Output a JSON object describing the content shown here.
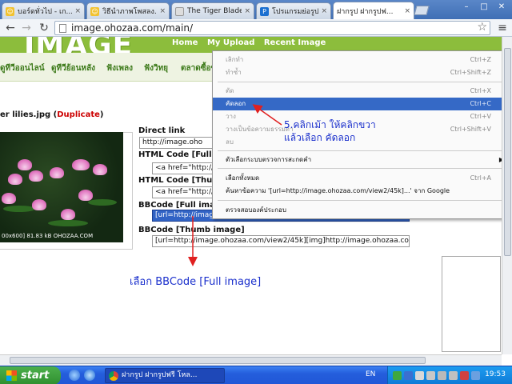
{
  "tabs": [
    {
      "title": "บอร์ดทั่วไป - เก...",
      "active": false
    },
    {
      "title": "วิธีนำภาพโพสลง...",
      "active": false
    },
    {
      "title": "The Tiger Blade",
      "active": false
    },
    {
      "title": "โปรแกรมย่อรูป",
      "active": false
    },
    {
      "title": "ฝากรูป ฝากรูปฟ...",
      "active": true
    }
  ],
  "toolbar": {
    "url": "image.ohozaa.com/main/",
    "back_icon": "back-arrow",
    "forward_icon": "forward-arrow",
    "reload_icon": "reload",
    "bookmark_icon": "star",
    "menu_icon": "wrench"
  },
  "site": {
    "logo": "IMAGE",
    "topnav": [
      "Home",
      "My Upload",
      "Recent Image"
    ],
    "catnav": [
      "ดูทีวีออนไลน์",
      "ดูทีวีย้อนหลัง",
      "ฟังเพลง",
      "ฟังวิทยุ",
      "ตลาดซื้อข"
    ],
    "file_title": "er lilies.jpg",
    "file_title_paren_open": " (",
    "file_dup": "Duplicate",
    "file_title_paren_close": ")",
    "photo_caption": "00x600] 81.83 kB OHOZAA.COM"
  },
  "codes": {
    "direct_link_label": "Direct link",
    "direct_link_value": "http://image.oho",
    "html_full_label": "HTML Code [Full ima",
    "html_full_value": "<a href=\"http://i",
    "html_thumb_label": "HTML Code [Thumb",
    "html_thumb_value": "<a href=\"http://i",
    "bb_full_label": "BBCode [Full image",
    "bb_full_value": "[url=http://image.ohozaa.com/view2/45k][img]http://image.ohozaa.co",
    "bb_thumb_label": "BBCode [Thumb image]",
    "bb_thumb_value": "[url=http://image.ohozaa.com/view2/45k][img]http://image.ohozaa.com"
  },
  "context_menu": {
    "items": [
      {
        "label": "เลิกทำ",
        "shortcut": "Ctrl+Z",
        "disabled": true
      },
      {
        "label": "ทำซ้ำ",
        "shortcut": "Ctrl+Shift+Z",
        "disabled": true
      },
      {
        "label": "ตัด",
        "shortcut": "Ctrl+X",
        "disabled": true
      },
      {
        "label": "คัดลอก",
        "shortcut": "Ctrl+C",
        "highlighted": true
      },
      {
        "label": "วาง",
        "shortcut": "Ctrl+V",
        "disabled": true
      },
      {
        "label": "วางเป็นข้อความธรรมดา",
        "shortcut": "Ctrl+Shift+V",
        "disabled": true
      },
      {
        "label": "ลบ",
        "shortcut": "",
        "disabled": true
      },
      {
        "label": "ตัวเลือกระบบตรวจการสะกดคำ",
        "shortcut": "",
        "submenu": true
      },
      {
        "label": "เลือกทั้งหมด",
        "shortcut": "Ctrl+A"
      },
      {
        "label": "ค้นหาข้อความ '[url=http://image.ohozaa.com/view2/45k]...' จาก Google",
        "shortcut": ""
      },
      {
        "label": "ตรวจสอบองค์ประกอบ",
        "shortcut": ""
      }
    ]
  },
  "annotations": {
    "step5_line1": "5.คลิกเม้า ให้คลิกขวา",
    "step5_line2": "แล้วเลือก คัดลอก",
    "bbcode_note": "เลือก BBCode [Full image]"
  },
  "taskbar": {
    "start_label": "start",
    "task_item": "ฝากรูป ฝากรูปฟรี โหล...",
    "language": "EN",
    "clock": "19:53"
  }
}
